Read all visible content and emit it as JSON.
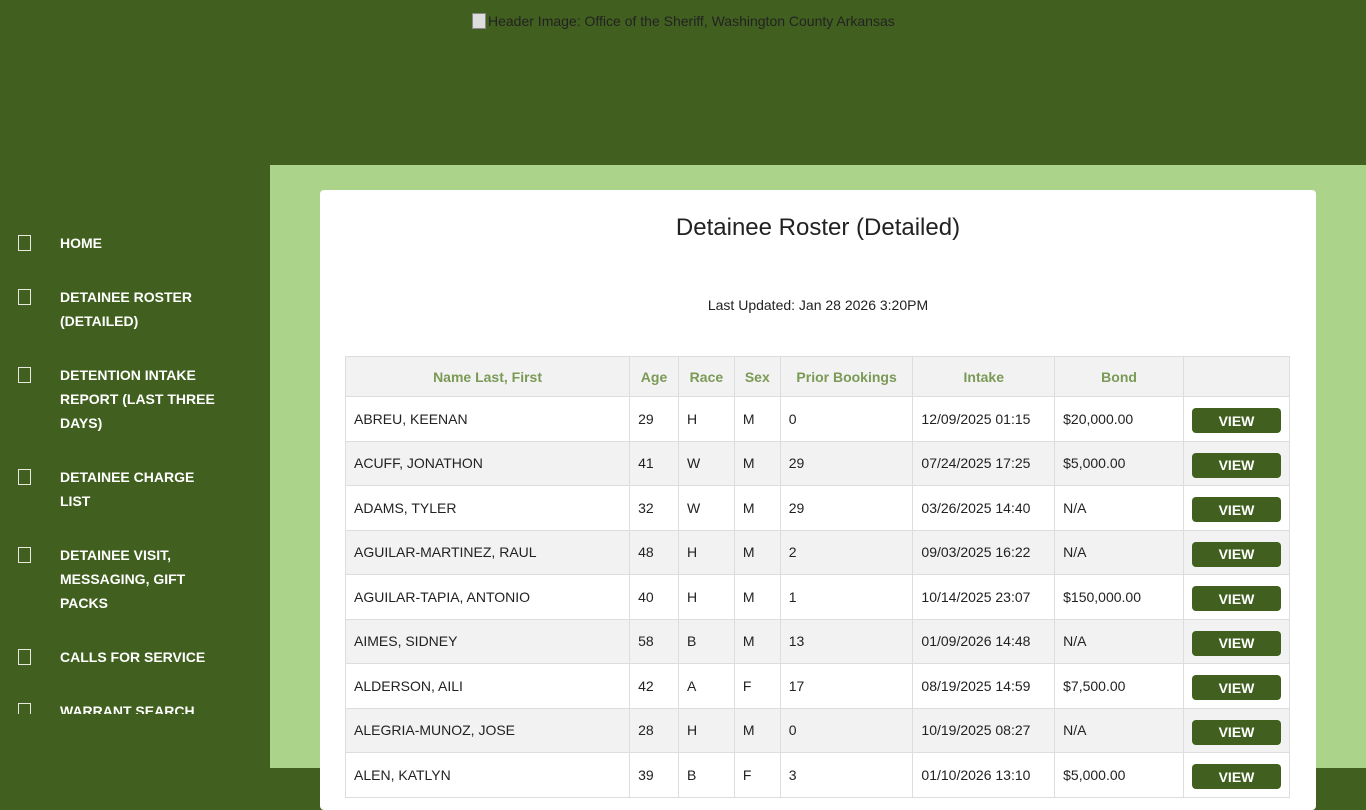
{
  "header": {
    "image_alt": "Header Image: Office of the Sheriff, Washington County Arkansas"
  },
  "sidebar": {
    "items": [
      {
        "label": "HOME"
      },
      {
        "label": "DETAINEE ROSTER (DETAILED)"
      },
      {
        "label": "DETENTION INTAKE REPORT (LAST THREE DAYS)"
      },
      {
        "label": "DETAINEE CHARGE LIST"
      },
      {
        "label": "DETAINEE VISIT, MESSAGING, GIFT PACKS"
      },
      {
        "label": "CALLS FOR SERVICE"
      },
      {
        "label": "WARRANT SEARCH"
      }
    ]
  },
  "page": {
    "title": "Detainee Roster (Detailed)",
    "last_updated": "Last Updated: Jan 28 2026 3:20PM"
  },
  "table": {
    "headers": [
      "Name Last, First",
      "Age",
      "Race",
      "Sex",
      "Prior Bookings",
      "Intake",
      "Bond",
      ""
    ],
    "view_label": "VIEW",
    "rows": [
      [
        "ABREU, KEENAN",
        "29",
        "H",
        "M",
        "0",
        "12/09/2025 01:15",
        "$20,000.00"
      ],
      [
        "ACUFF, JONATHON",
        "41",
        "W",
        "M",
        "29",
        "07/24/2025 17:25",
        "$5,000.00"
      ],
      [
        "ADAMS, TYLER",
        "32",
        "W",
        "M",
        "29",
        "03/26/2025 14:40",
        "N/A"
      ],
      [
        "AGUILAR-MARTINEZ, RAUL",
        "48",
        "H",
        "M",
        "2",
        "09/03/2025 16:22",
        "N/A"
      ],
      [
        "AGUILAR-TAPIA, ANTONIO",
        "40",
        "H",
        "M",
        "1",
        "10/14/2025 23:07",
        "$150,000.00"
      ],
      [
        "AIMES, SIDNEY",
        "58",
        "B",
        "M",
        "13",
        "01/09/2026 14:48",
        "N/A"
      ],
      [
        "ALDERSON, AILI",
        "42",
        "A",
        "F",
        "17",
        "08/19/2025 14:59",
        "$7,500.00"
      ],
      [
        "ALEGRIA-MUNOZ, JOSE",
        "28",
        "H",
        "M",
        "0",
        "10/19/2025 08:27",
        "N/A"
      ],
      [
        "ALEN, KATLYN",
        "39",
        "B",
        "F",
        "3",
        "01/10/2026 13:10",
        "$5,000.00"
      ]
    ]
  }
}
